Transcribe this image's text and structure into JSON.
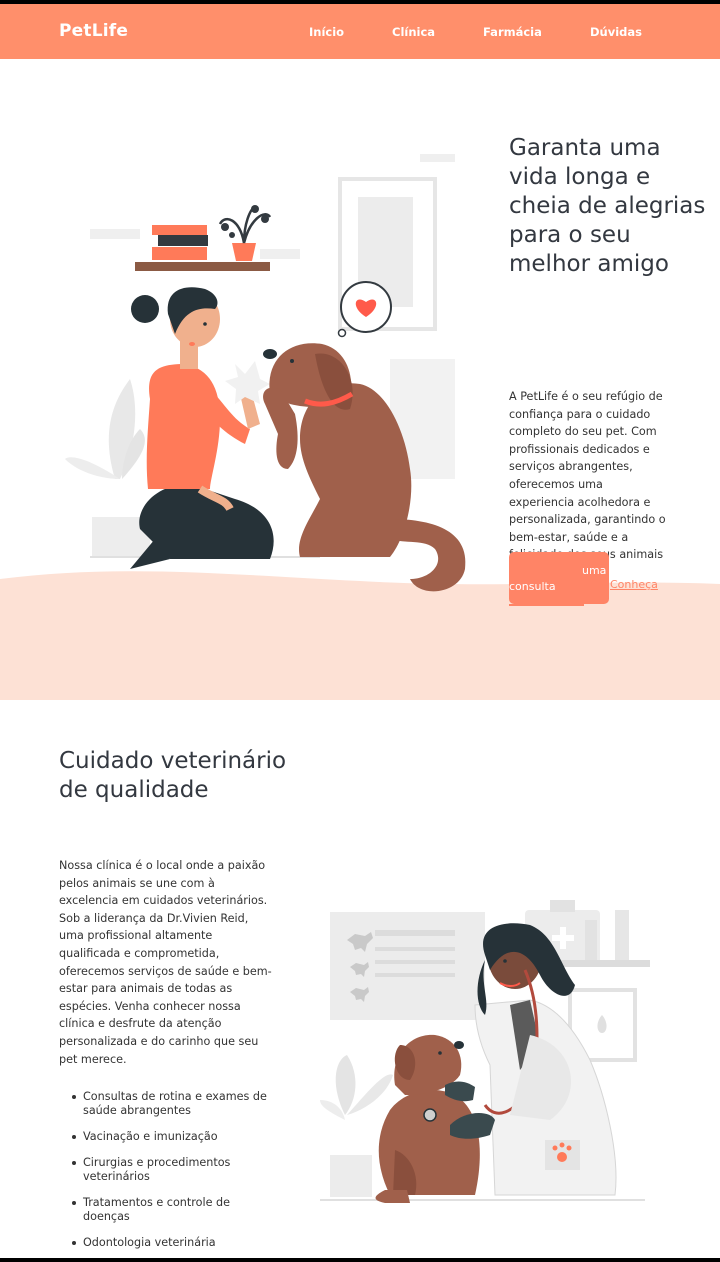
{
  "brand": {
    "name": "PetLife"
  },
  "nav": {
    "items": [
      {
        "label": "Início"
      },
      {
        "label": "Clínica"
      },
      {
        "label": "Farmácia"
      },
      {
        "label": "Dúvidas"
      }
    ]
  },
  "hero": {
    "title": "Garanta uma vida longa e cheia de alegrias para o seu melhor amigo",
    "text": "A PetLife é o seu refúgio de confiança para o cuidado completo do seu pet. Com profissionais dedicados e serviços abrangentes, oferecemos uma experiencia acolhedora e personalizada, garantindo o bem-estar, saúde e a felicidade dos seus animais de estimação.",
    "button_consulta_word1": "uma",
    "button_consulta_word2": "consulta",
    "button_conheca": "Conheça"
  },
  "clinic": {
    "title": "Cuidado veterinário de qualidade",
    "text": "Nossa clínica é o local onde a paixão pelos animais se une com à excelencia em cuidados veterinários. Sob a liderança da Dr.Vivien Reid, uma profissional altamente qualificada e comprometida, oferecemos serviços de saúde e bem-estar para animais de todas as espécies. Venha conhecer nossa clínica e desfrute da atenção personalizada e do carinho que seu pet merece.",
    "services": [
      "Consultas de rotina e exames de saúde abrangentes",
      "Vacinação e imunização",
      "Cirurgias e procedimentos veterinários",
      "Tratamentos e controle de doenças",
      "Odontologia veterinária"
    ]
  },
  "colors": {
    "primary": "#ff8f6b",
    "button": "#ff8466",
    "wave": "#fde1d5",
    "title": "#333840"
  }
}
